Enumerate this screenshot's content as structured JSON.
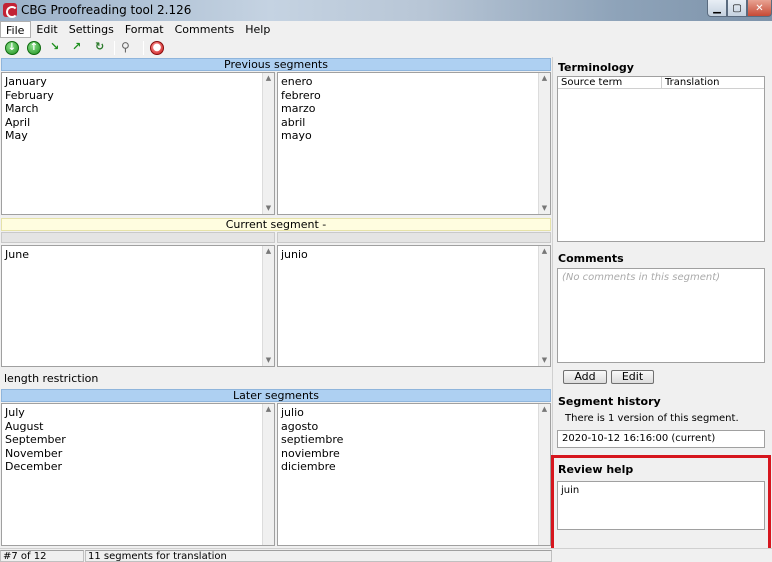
{
  "window": {
    "title": "CBG Proofreading tool 2.126"
  },
  "menu": [
    "File",
    "Edit",
    "Settings",
    "Format",
    "Comments",
    "Help"
  ],
  "panels": {
    "previous": {
      "header": "Previous segments",
      "source": [
        "January",
        "February",
        "March",
        "April",
        "May"
      ],
      "target": [
        "enero",
        "febrero",
        "marzo",
        "abril",
        "mayo"
      ]
    },
    "current": {
      "header": "Current segment -",
      "source": [
        "June"
      ],
      "target": [
        "junio"
      ],
      "length_label": "length restriction"
    },
    "later": {
      "header": "Later segments",
      "source": [
        "July",
        "August",
        "September",
        "November",
        "December"
      ],
      "target": [
        "julio",
        "agosto",
        "septiembre",
        "noviembre",
        "diciembre"
      ]
    }
  },
  "sidebar": {
    "terminology": {
      "title": "Terminology",
      "col_source": "Source term",
      "col_translation": "Translation"
    },
    "comments": {
      "title": "Comments",
      "placeholder": "(No comments in this segment)",
      "add_label": "Add",
      "edit_label": "Edit"
    },
    "history": {
      "title": "Segment history",
      "summary": "There is 1 version of this segment.",
      "entry": "2020-10-12 16:16:00 (current)"
    },
    "review": {
      "title": "Review help",
      "text": "juin",
      "highlight_color": "#d6161e"
    }
  },
  "status": {
    "position": "#7 of 12",
    "count": "11 segments for translation"
  }
}
